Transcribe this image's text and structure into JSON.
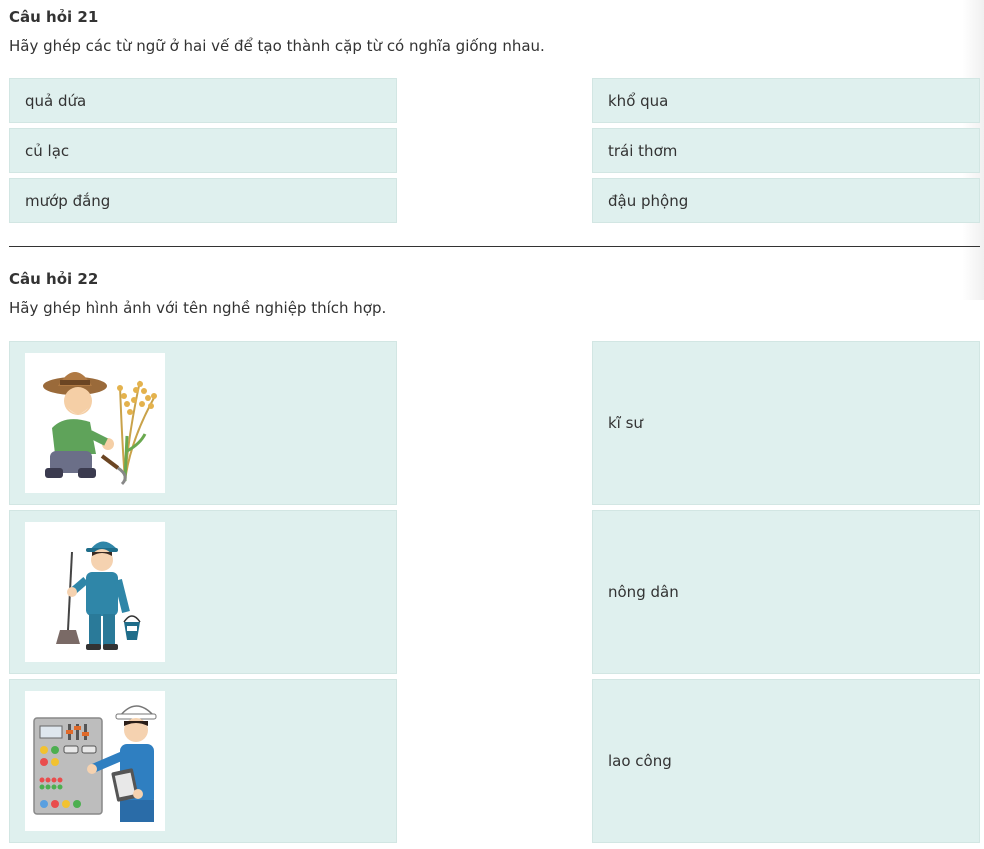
{
  "q21": {
    "title": "Câu hỏi 21",
    "instruction": "Hãy ghép các từ ngữ ở hai vế để tạo thành cặp từ có nghĩa giống nhau.",
    "left": [
      "quả dứa",
      "củ lạc",
      "mướp đắng"
    ],
    "right": [
      "khổ qua",
      "trái thơm",
      "đậu phộng"
    ]
  },
  "q22": {
    "title": "Câu hỏi 22",
    "instruction": "Hãy ghép hình ảnh với tên nghề nghiệp thích hợp.",
    "left_images": [
      "farmer-image",
      "cleaner-image",
      "engineer-image"
    ],
    "right": [
      "kĩ sư",
      "nông dân",
      "lao công"
    ]
  },
  "colors": {
    "card_bg": "#dff0ee",
    "card_border": "#d2e6e3",
    "text": "#333333",
    "divider": "#333333"
  }
}
